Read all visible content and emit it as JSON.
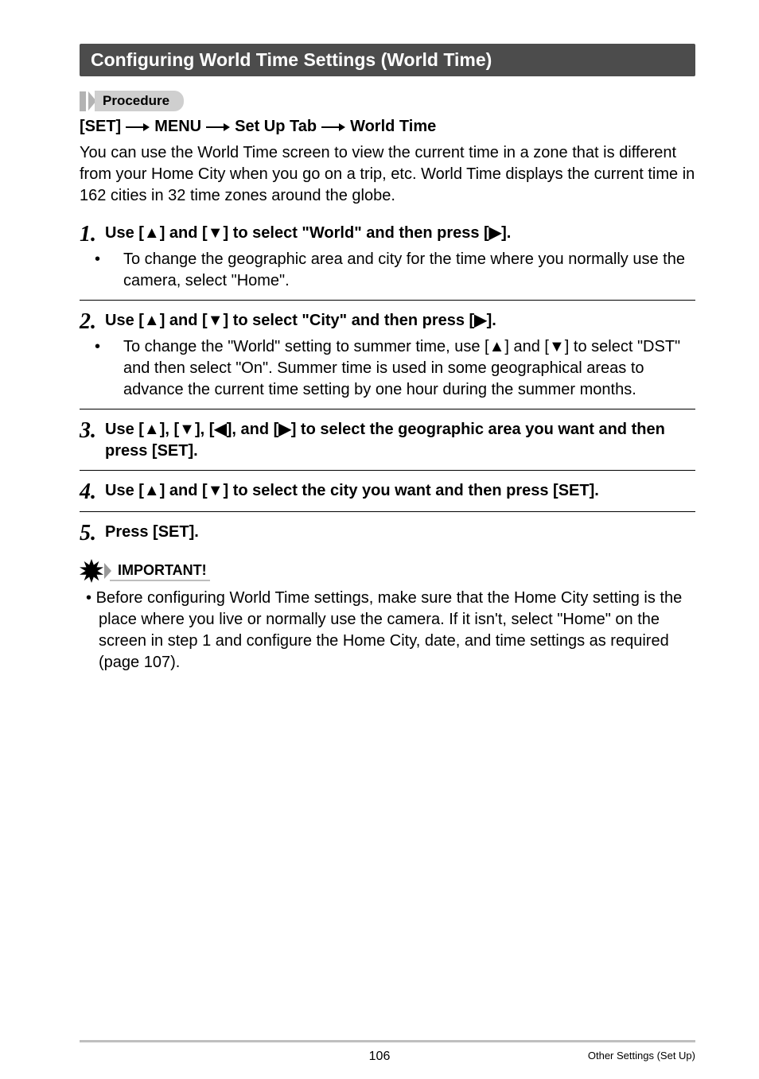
{
  "heading": "Configuring World Time Settings (World Time)",
  "procedure_label": "Procedure",
  "breadcrumb": {
    "a": "[SET]",
    "b": "MENU",
    "c": "Set Up Tab",
    "d": "World Time"
  },
  "intro": "You can use the World Time screen to view the current time in a zone that is different from your Home City when you go on a trip, etc. World Time displays the current time in 162 cities in 32 time zones around the globe.",
  "steps": [
    {
      "num": "1.",
      "title_pre": "Use [",
      "t1": "▲",
      "title_mid1": "] and [",
      "t2": "▼",
      "title_mid2": "] to select \"World\" and then press [",
      "t3": "▶",
      "title_post": "].",
      "sub": "To change the geographic area and city for the time where you normally use the camera, select \"Home\"."
    },
    {
      "num": "2.",
      "title_pre": "Use [",
      "t1": "▲",
      "title_mid1": "] and [",
      "t2": "▼",
      "title_mid2": "] to select \"City\" and then press [",
      "t3": "▶",
      "title_post": "].",
      "sub_pre": "To change the \"World\" setting to summer time, use [",
      "s1": "▲",
      "sub_mid": "] and [",
      "s2": "▼",
      "sub_post": "] to select \"DST\" and then select \"On\". Summer time is used in some geographical areas to advance the current time setting by one hour during the summer months."
    },
    {
      "num": "3.",
      "title_pre": "Use [",
      "t1": "▲",
      "title_mid1": "], [",
      "t2": "▼",
      "title_mid2": "], [",
      "t3": "◀",
      "title_mid3": "], and [",
      "t4": "▶",
      "title_post": "] to select the geographic area you want and then press [SET]."
    },
    {
      "num": "4.",
      "title_pre": "Use [",
      "t1": "▲",
      "title_mid1": "] and [",
      "t2": "▼",
      "title_post": "] to select the city you want and then press [SET]."
    },
    {
      "num": "5.",
      "title_pre": "Press [SET]."
    }
  ],
  "important_label": "IMPORTANT!",
  "important_note": "Before configuring World Time settings, make sure that the Home City setting is the place where you live or normally use the camera. If it isn't, select \"Home\" on the screen in step 1 and configure the Home City, date, and time settings as required (page 107).",
  "footer": {
    "page": "106",
    "section": "Other Settings (Set Up)"
  }
}
